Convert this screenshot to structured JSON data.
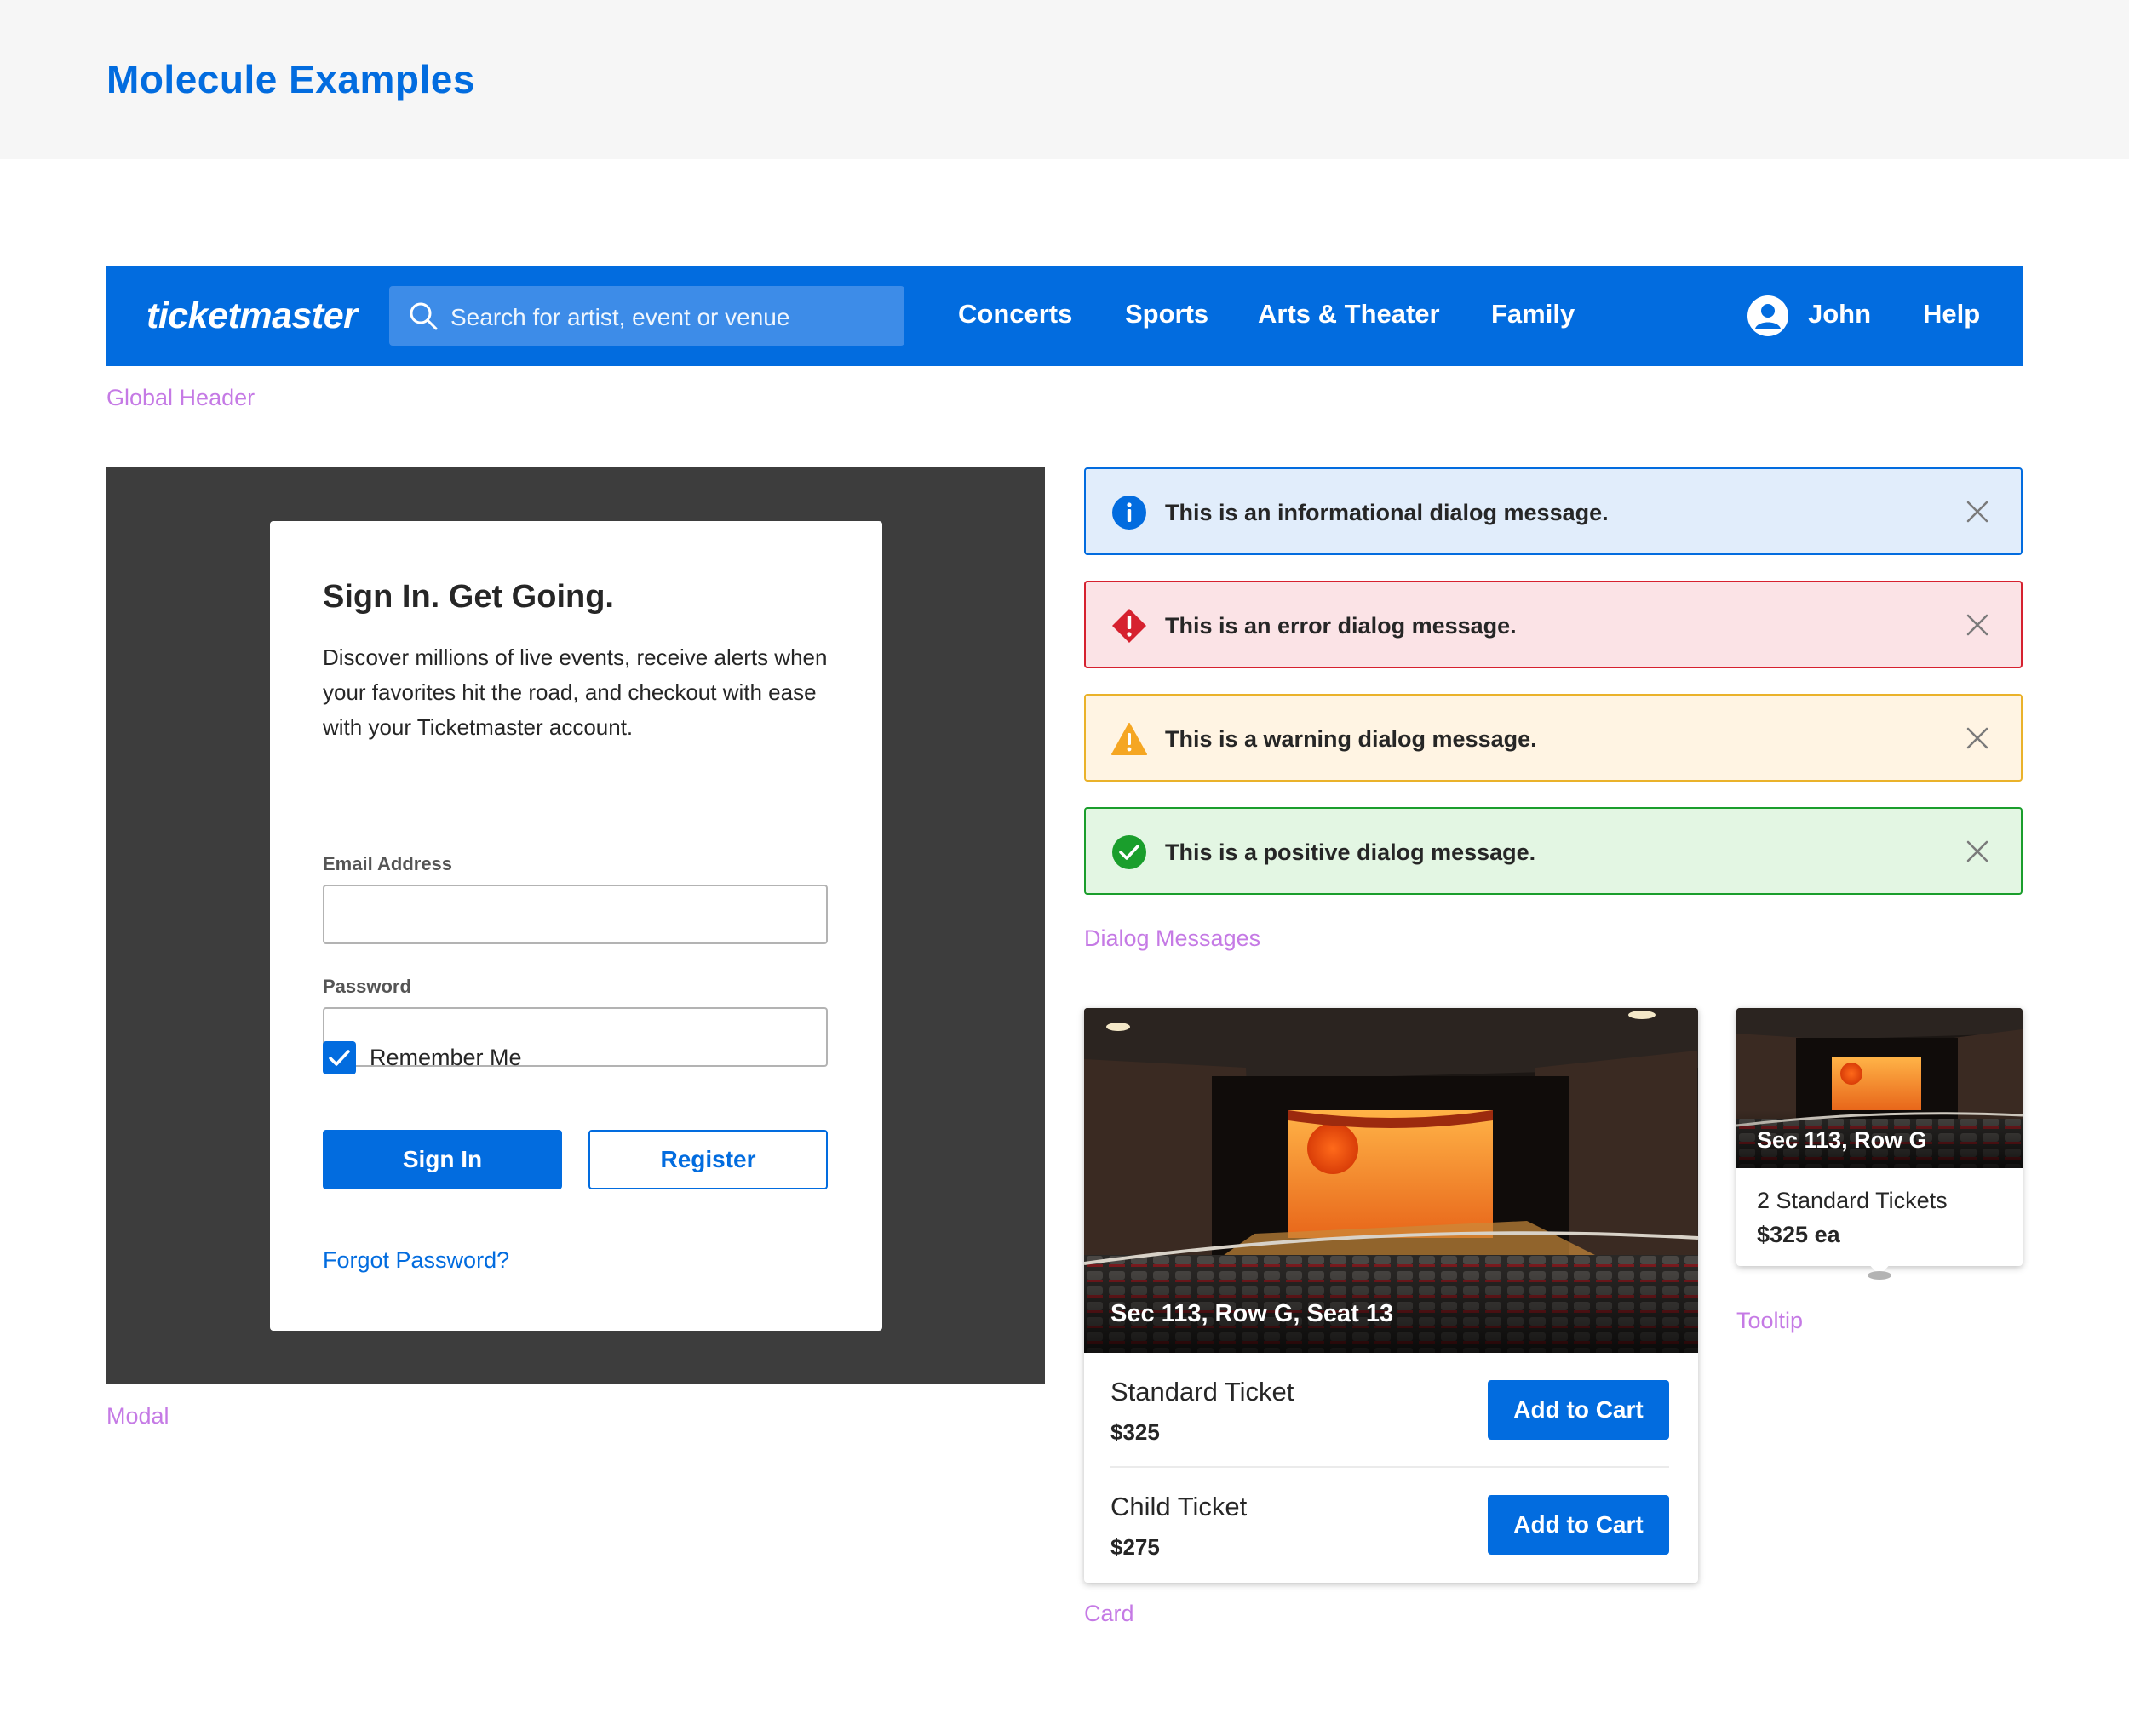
{
  "page": {
    "title": "Molecule Examples"
  },
  "captions": {
    "global_header": "Global Header",
    "modal": "Modal",
    "dialog_messages": "Dialog Messages",
    "card": "Card",
    "tooltip": "Tooltip"
  },
  "header": {
    "logo": "ticketmaster",
    "search_placeholder": "Search for artist, event or venue",
    "nav": [
      "Concerts",
      "Sports",
      "Arts & Theater",
      "Family"
    ],
    "user_name": "John",
    "help": "Help",
    "brand_color": "#026cdf"
  },
  "modal": {
    "title": "Sign In. Get Going.",
    "description": "Discover millions of live events, receive alerts when your favorites hit the road, and checkout with ease with your Ticketmaster account.",
    "email_label": "Email Address",
    "email_value": "",
    "password_label": "Password",
    "password_value": "",
    "remember_me_label": "Remember Me",
    "remember_me_checked": true,
    "sign_in_label": "Sign In",
    "register_label": "Register",
    "forgot_password_label": "Forgot Password?"
  },
  "dialogs": [
    {
      "type": "info",
      "icon": "info-icon",
      "text": "This is an informational dialog message.",
      "color": "#026cdf"
    },
    {
      "type": "error",
      "icon": "error-icon",
      "text": "This is an error dialog message.",
      "color": "#d6212f"
    },
    {
      "type": "warning",
      "icon": "warning-icon",
      "text": "This is a warning dialog message.",
      "color": "#eab22a"
    },
    {
      "type": "positive",
      "icon": "check-circle-icon",
      "text": "This is a positive dialog message.",
      "color": "#1a9e2c"
    }
  ],
  "card": {
    "seat_caption": "Sec 113, Row G, Seat 13",
    "tickets": [
      {
        "name": "Standard Ticket",
        "price": "$325",
        "button": "Add to Cart"
      },
      {
        "name": "Child Ticket",
        "price": "$275",
        "button": "Add to Cart"
      }
    ]
  },
  "tooltip": {
    "seat_caption": "Sec 113, Row G",
    "tickets_line": "2 Standard Tickets",
    "price_line": "$325 ea"
  }
}
